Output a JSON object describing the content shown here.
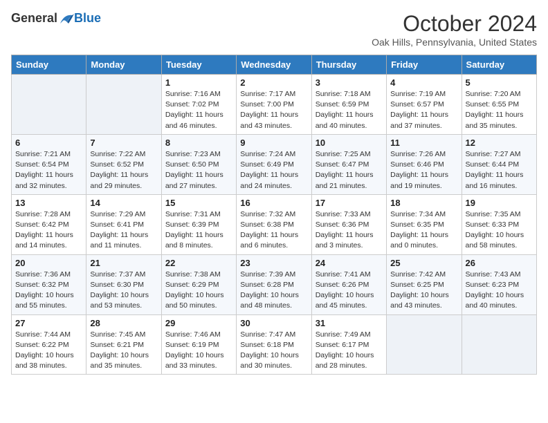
{
  "header": {
    "logo": {
      "general": "General",
      "blue": "Blue"
    },
    "title": "October 2024",
    "location": "Oak Hills, Pennsylvania, United States"
  },
  "weekdays": [
    "Sunday",
    "Monday",
    "Tuesday",
    "Wednesday",
    "Thursday",
    "Friday",
    "Saturday"
  ],
  "weeks": [
    [
      {
        "day": "",
        "sunrise": "",
        "sunset": "",
        "daylight": ""
      },
      {
        "day": "",
        "sunrise": "",
        "sunset": "",
        "daylight": ""
      },
      {
        "day": "1",
        "sunrise": "Sunrise: 7:16 AM",
        "sunset": "Sunset: 7:02 PM",
        "daylight": "Daylight: 11 hours and 46 minutes."
      },
      {
        "day": "2",
        "sunrise": "Sunrise: 7:17 AM",
        "sunset": "Sunset: 7:00 PM",
        "daylight": "Daylight: 11 hours and 43 minutes."
      },
      {
        "day": "3",
        "sunrise": "Sunrise: 7:18 AM",
        "sunset": "Sunset: 6:59 PM",
        "daylight": "Daylight: 11 hours and 40 minutes."
      },
      {
        "day": "4",
        "sunrise": "Sunrise: 7:19 AM",
        "sunset": "Sunset: 6:57 PM",
        "daylight": "Daylight: 11 hours and 37 minutes."
      },
      {
        "day": "5",
        "sunrise": "Sunrise: 7:20 AM",
        "sunset": "Sunset: 6:55 PM",
        "daylight": "Daylight: 11 hours and 35 minutes."
      }
    ],
    [
      {
        "day": "6",
        "sunrise": "Sunrise: 7:21 AM",
        "sunset": "Sunset: 6:54 PM",
        "daylight": "Daylight: 11 hours and 32 minutes."
      },
      {
        "day": "7",
        "sunrise": "Sunrise: 7:22 AM",
        "sunset": "Sunset: 6:52 PM",
        "daylight": "Daylight: 11 hours and 29 minutes."
      },
      {
        "day": "8",
        "sunrise": "Sunrise: 7:23 AM",
        "sunset": "Sunset: 6:50 PM",
        "daylight": "Daylight: 11 hours and 27 minutes."
      },
      {
        "day": "9",
        "sunrise": "Sunrise: 7:24 AM",
        "sunset": "Sunset: 6:49 PM",
        "daylight": "Daylight: 11 hours and 24 minutes."
      },
      {
        "day": "10",
        "sunrise": "Sunrise: 7:25 AM",
        "sunset": "Sunset: 6:47 PM",
        "daylight": "Daylight: 11 hours and 21 minutes."
      },
      {
        "day": "11",
        "sunrise": "Sunrise: 7:26 AM",
        "sunset": "Sunset: 6:46 PM",
        "daylight": "Daylight: 11 hours and 19 minutes."
      },
      {
        "day": "12",
        "sunrise": "Sunrise: 7:27 AM",
        "sunset": "Sunset: 6:44 PM",
        "daylight": "Daylight: 11 hours and 16 minutes."
      }
    ],
    [
      {
        "day": "13",
        "sunrise": "Sunrise: 7:28 AM",
        "sunset": "Sunset: 6:42 PM",
        "daylight": "Daylight: 11 hours and 14 minutes."
      },
      {
        "day": "14",
        "sunrise": "Sunrise: 7:29 AM",
        "sunset": "Sunset: 6:41 PM",
        "daylight": "Daylight: 11 hours and 11 minutes."
      },
      {
        "day": "15",
        "sunrise": "Sunrise: 7:31 AM",
        "sunset": "Sunset: 6:39 PM",
        "daylight": "Daylight: 11 hours and 8 minutes."
      },
      {
        "day": "16",
        "sunrise": "Sunrise: 7:32 AM",
        "sunset": "Sunset: 6:38 PM",
        "daylight": "Daylight: 11 hours and 6 minutes."
      },
      {
        "day": "17",
        "sunrise": "Sunrise: 7:33 AM",
        "sunset": "Sunset: 6:36 PM",
        "daylight": "Daylight: 11 hours and 3 minutes."
      },
      {
        "day": "18",
        "sunrise": "Sunrise: 7:34 AM",
        "sunset": "Sunset: 6:35 PM",
        "daylight": "Daylight: 11 hours and 0 minutes."
      },
      {
        "day": "19",
        "sunrise": "Sunrise: 7:35 AM",
        "sunset": "Sunset: 6:33 PM",
        "daylight": "Daylight: 10 hours and 58 minutes."
      }
    ],
    [
      {
        "day": "20",
        "sunrise": "Sunrise: 7:36 AM",
        "sunset": "Sunset: 6:32 PM",
        "daylight": "Daylight: 10 hours and 55 minutes."
      },
      {
        "day": "21",
        "sunrise": "Sunrise: 7:37 AM",
        "sunset": "Sunset: 6:30 PM",
        "daylight": "Daylight: 10 hours and 53 minutes."
      },
      {
        "day": "22",
        "sunrise": "Sunrise: 7:38 AM",
        "sunset": "Sunset: 6:29 PM",
        "daylight": "Daylight: 10 hours and 50 minutes."
      },
      {
        "day": "23",
        "sunrise": "Sunrise: 7:39 AM",
        "sunset": "Sunset: 6:28 PM",
        "daylight": "Daylight: 10 hours and 48 minutes."
      },
      {
        "day": "24",
        "sunrise": "Sunrise: 7:41 AM",
        "sunset": "Sunset: 6:26 PM",
        "daylight": "Daylight: 10 hours and 45 minutes."
      },
      {
        "day": "25",
        "sunrise": "Sunrise: 7:42 AM",
        "sunset": "Sunset: 6:25 PM",
        "daylight": "Daylight: 10 hours and 43 minutes."
      },
      {
        "day": "26",
        "sunrise": "Sunrise: 7:43 AM",
        "sunset": "Sunset: 6:23 PM",
        "daylight": "Daylight: 10 hours and 40 minutes."
      }
    ],
    [
      {
        "day": "27",
        "sunrise": "Sunrise: 7:44 AM",
        "sunset": "Sunset: 6:22 PM",
        "daylight": "Daylight: 10 hours and 38 minutes."
      },
      {
        "day": "28",
        "sunrise": "Sunrise: 7:45 AM",
        "sunset": "Sunset: 6:21 PM",
        "daylight": "Daylight: 10 hours and 35 minutes."
      },
      {
        "day": "29",
        "sunrise": "Sunrise: 7:46 AM",
        "sunset": "Sunset: 6:19 PM",
        "daylight": "Daylight: 10 hours and 33 minutes."
      },
      {
        "day": "30",
        "sunrise": "Sunrise: 7:47 AM",
        "sunset": "Sunset: 6:18 PM",
        "daylight": "Daylight: 10 hours and 30 minutes."
      },
      {
        "day": "31",
        "sunrise": "Sunrise: 7:49 AM",
        "sunset": "Sunset: 6:17 PM",
        "daylight": "Daylight: 10 hours and 28 minutes."
      },
      {
        "day": "",
        "sunrise": "",
        "sunset": "",
        "daylight": ""
      },
      {
        "day": "",
        "sunrise": "",
        "sunset": "",
        "daylight": ""
      }
    ]
  ]
}
